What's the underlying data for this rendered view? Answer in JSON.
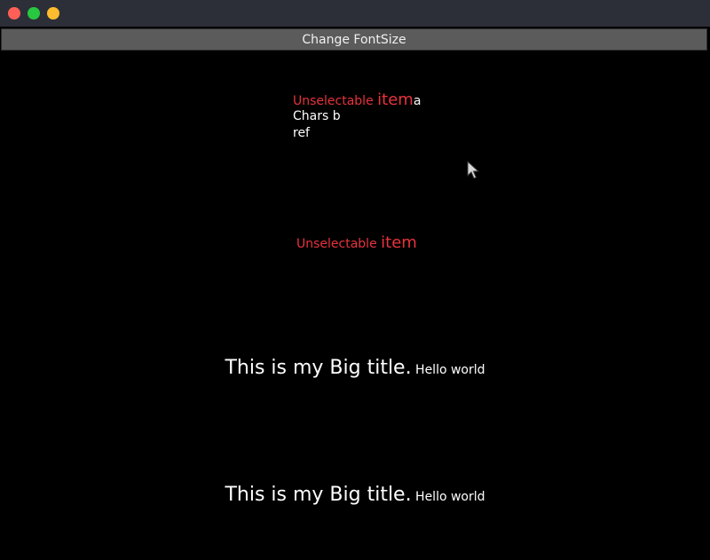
{
  "toolbar": {
    "change_font_label": "Change FontSize"
  },
  "block1": {
    "unselectable_small": "Unselectable ",
    "unselectable_big": "item",
    "trailing_char": "a",
    "line2": "Chars b",
    "line3": "ref"
  },
  "block2": {
    "unselectable_small": "Unselectable ",
    "unselectable_big": "item"
  },
  "title_rows": [
    {
      "big": "This is my Big title.",
      "small": " Hello world"
    },
    {
      "big": "This is my Big title.",
      "small": " Hello world"
    }
  ],
  "colors": {
    "accent_red": "#e8333c",
    "background": "#000000",
    "titlebar": "#2c2f38",
    "button": "#5b5b5b"
  },
  "icons": {
    "close": "close-icon",
    "minimize": "minimize-icon",
    "zoom": "zoom-icon",
    "cursor": "mouse-pointer-icon"
  }
}
